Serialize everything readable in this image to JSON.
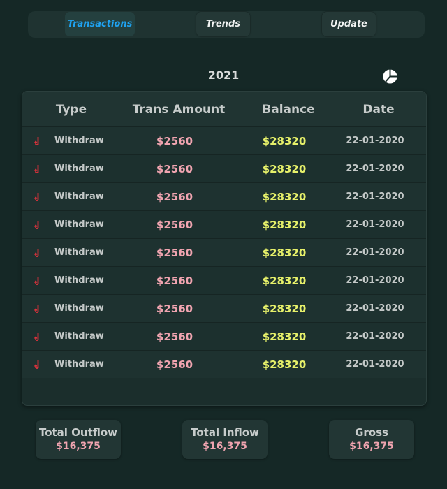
{
  "tabs": {
    "transactions": "Transactions",
    "trends": "Trends",
    "update": "Update"
  },
  "year": "2021",
  "icons": {
    "chart": "pie-chart-icon",
    "row": "withdraw-arrow-icon"
  },
  "colors": {
    "active_tab": "#1fa3f2",
    "amount": "#f0a4b0",
    "balance": "#e6f06a",
    "withdraw_icon": "#e0323c"
  },
  "table": {
    "headers": {
      "type": "Type",
      "amount": "Trans Amount",
      "balance": "Balance",
      "date": "Date"
    },
    "rows": [
      {
        "type": "Withdraw",
        "amount": "$2560",
        "balance": "$28320",
        "date": "22-01-2020"
      },
      {
        "type": "Withdraw",
        "amount": "$2560",
        "balance": "$28320",
        "date": "22-01-2020"
      },
      {
        "type": "Withdraw",
        "amount": "$2560",
        "balance": "$28320",
        "date": "22-01-2020"
      },
      {
        "type": "Withdraw",
        "amount": "$2560",
        "balance": "$28320",
        "date": "22-01-2020"
      },
      {
        "type": "Withdraw",
        "amount": "$2560",
        "balance": "$28320",
        "date": "22-01-2020"
      },
      {
        "type": "Withdraw",
        "amount": "$2560",
        "balance": "$28320",
        "date": "22-01-2020"
      },
      {
        "type": "Withdraw",
        "amount": "$2560",
        "balance": "$28320",
        "date": "22-01-2020"
      },
      {
        "type": "Withdraw",
        "amount": "$2560",
        "balance": "$28320",
        "date": "22-01-2020"
      },
      {
        "type": "Withdraw",
        "amount": "$2560",
        "balance": "$28320",
        "date": "22-01-2020"
      }
    ]
  },
  "totals": {
    "outflow": {
      "label": "Total Outflow",
      "value": "$16,375"
    },
    "inflow": {
      "label": "Total Inflow",
      "value": "$16,375"
    },
    "gross": {
      "label": "Gross",
      "value": "$16,375"
    }
  }
}
